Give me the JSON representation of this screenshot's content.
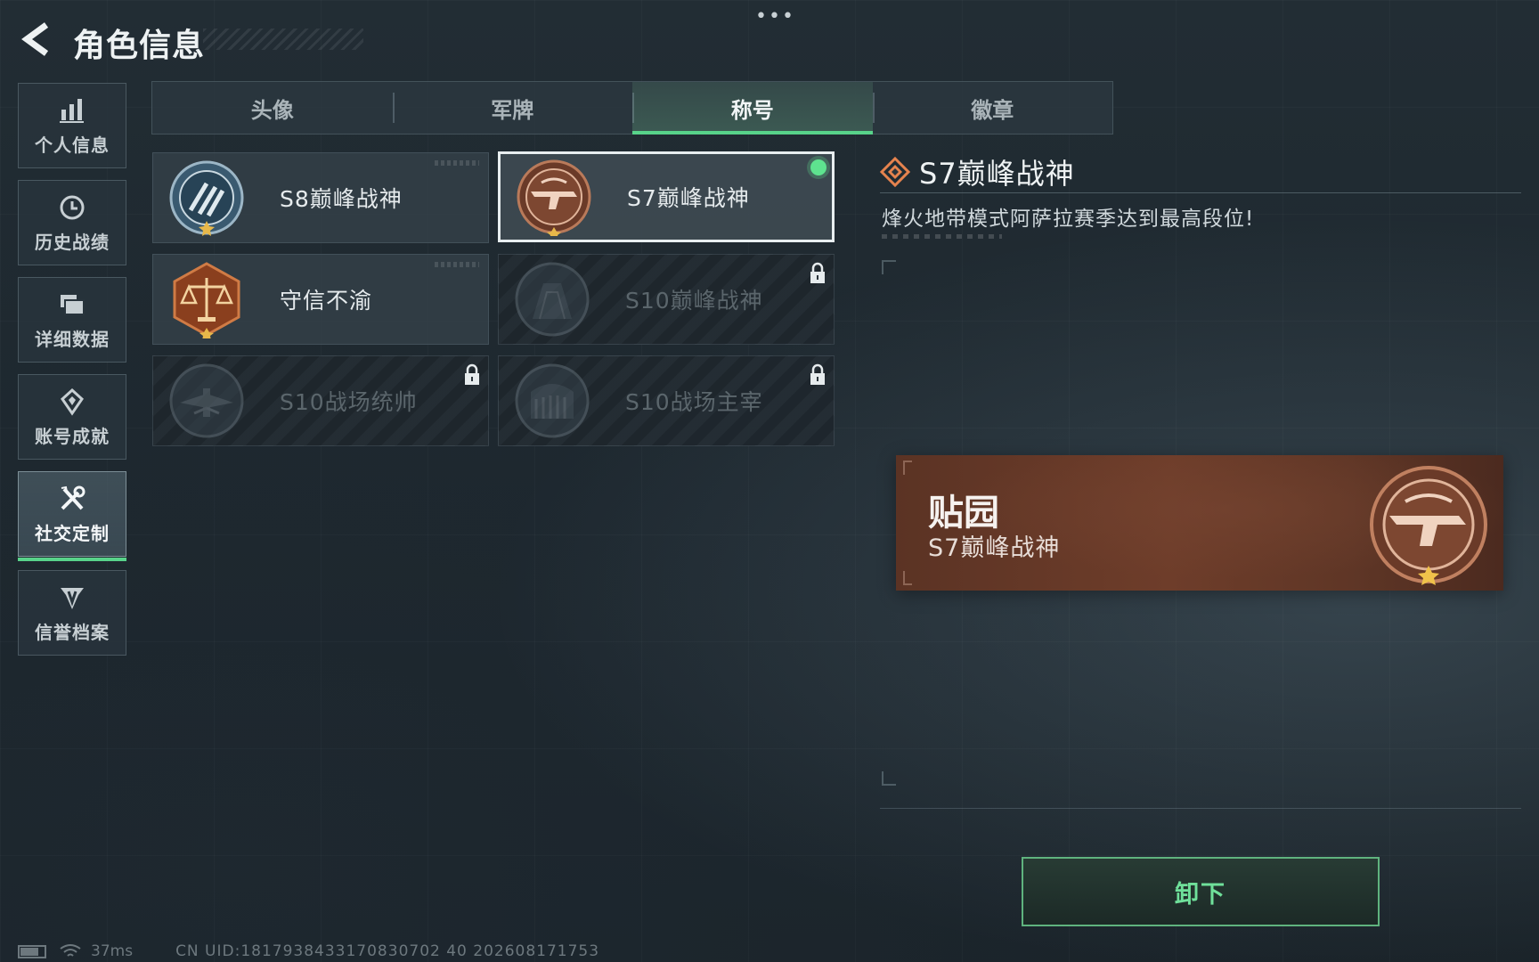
{
  "header": {
    "title": "角色信息",
    "more": "•••"
  },
  "sidebar": {
    "items": [
      {
        "label": "个人信息",
        "icon": "bar-chart-icon",
        "active": false
      },
      {
        "label": "历史战绩",
        "icon": "history-clock-icon",
        "active": false
      },
      {
        "label": "详细数据",
        "icon": "folder-data-icon",
        "active": false
      },
      {
        "label": "账号成就",
        "icon": "achievement-icon",
        "active": false
      },
      {
        "label": "社交定制",
        "icon": "tools-icon",
        "active": true
      },
      {
        "label": "信誉档案",
        "icon": "credit-shield-icon",
        "active": false
      }
    ]
  },
  "tabs": [
    {
      "label": "头像",
      "active": false
    },
    {
      "label": "军牌",
      "active": false
    },
    {
      "label": "称号",
      "active": true
    },
    {
      "label": "徽章",
      "active": false
    }
  ],
  "titles": [
    {
      "name": "S8巅峰战神",
      "badge": "s8-peak-badge-icon",
      "locked": false,
      "selected": false,
      "equipped": false
    },
    {
      "name": "S7巅峰战神",
      "badge": "s7-peak-badge-icon",
      "locked": false,
      "selected": true,
      "equipped": true
    },
    {
      "name": "守信不渝",
      "badge": "justice-scale-badge-icon",
      "locked": false,
      "selected": false,
      "equipped": false
    },
    {
      "name": "S10巅峰战神",
      "badge": "s10-peak-badge-icon",
      "locked": true,
      "selected": false,
      "equipped": false
    },
    {
      "name": "S10战场统帅",
      "badge": "s10-commander-badge-icon",
      "locked": true,
      "selected": false,
      "equipped": false
    },
    {
      "name": "S10战场主宰",
      "badge": "s10-dominator-badge-icon",
      "locked": true,
      "selected": false,
      "equipped": false
    }
  ],
  "detail": {
    "title": "S7巅峰战神",
    "description": "烽火地带模式阿萨拉赛季达到最高段位!"
  },
  "nameplate": {
    "player_name": "贴园",
    "title": "S7巅峰战神"
  },
  "actions": {
    "unequip_label": "卸下"
  },
  "status_bar": {
    "ping": "37ms",
    "uid": "CN UID:1817938433170830702 40 202608171753"
  },
  "colors": {
    "accent_green": "#58d38a",
    "nameplate_copper": "#6e3d2a",
    "background": "#1f2a31"
  }
}
